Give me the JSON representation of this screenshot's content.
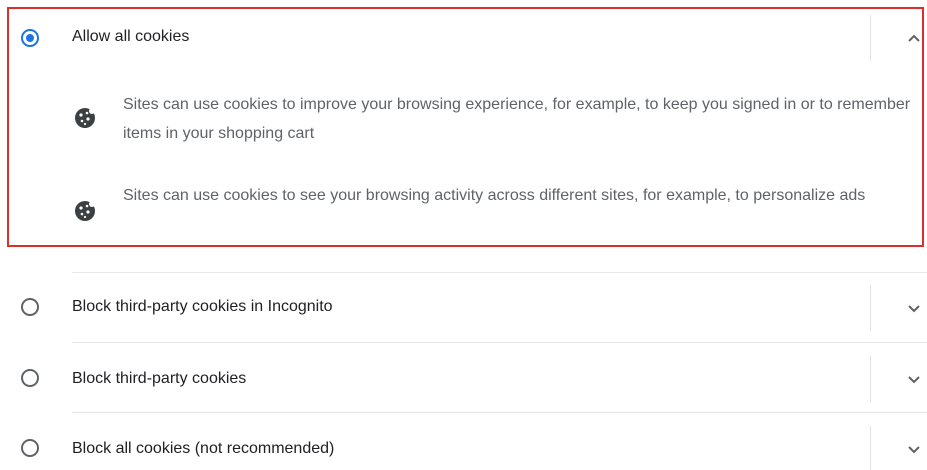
{
  "options": [
    {
      "label": "Allow all cookies",
      "selected": true,
      "expanded": true,
      "details": [
        {
          "icon": "cookie-icon",
          "text": "Sites can use cookies to improve your browsing experience, for example, to keep you signed in or to remember items in your shopping cart"
        },
        {
          "icon": "cookie-icon",
          "text": "Sites can use cookies to see your browsing activity across different sites, for example, to personalize ads"
        }
      ]
    },
    {
      "label": "Block third-party cookies in Incognito",
      "selected": false,
      "expanded": false
    },
    {
      "label": "Block third-party cookies",
      "selected": false,
      "expanded": false
    },
    {
      "label": "Block all cookies (not recommended)",
      "selected": false,
      "expanded": false
    }
  ],
  "colors": {
    "accent": "#1a73e8",
    "highlight_border": "#d9302b",
    "secondary_text": "#5f6368"
  }
}
